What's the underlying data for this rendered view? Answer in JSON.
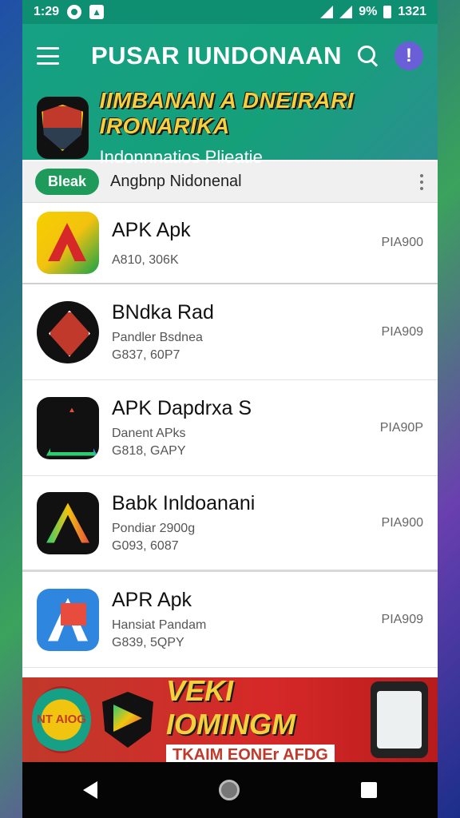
{
  "status_bar": {
    "time": "1:29",
    "battery": "9%",
    "clock": "1321"
  },
  "app_bar": {
    "title": "PUSAR IUNDONAAN",
    "banner_headline": "IIMBANAN A DNEIRARI IRONARIKA",
    "banner_subtitle": "Indonnnatios Plieatie"
  },
  "filter": {
    "chip_label": "Bleak",
    "label": "Angbnp Nidonenal"
  },
  "apps": [
    {
      "name": "APK Apk",
      "developer": "",
      "meta": "A810, 306K",
      "price": "PIA900"
    },
    {
      "name": "BNdka Rad",
      "developer": "Pandler Bsdnea",
      "meta": "G837, 60P7",
      "price": "PIA909"
    },
    {
      "name": "APK Dapdrxa S",
      "developer": "Danent APks",
      "meta": "G818, GAPY",
      "price": "PIA90P"
    },
    {
      "name": "Babk Inldoanani",
      "developer": "Pondiar 2900g",
      "meta": "G093, 6087",
      "price": "PIA900"
    },
    {
      "name": "APR Apk",
      "developer": "Hansiat Pandam",
      "meta": "G839, 5QPY",
      "price": "PIA909"
    }
  ],
  "promo": {
    "badge": "NT AIOG",
    "headline": "VEKI IOMINGM",
    "subline": "TKAIM EONEr AFDG"
  },
  "colors": {
    "primary": "#16a085",
    "chip": "#1e9a5b",
    "accent": "#6a5fd6",
    "promo": "#d62828"
  }
}
